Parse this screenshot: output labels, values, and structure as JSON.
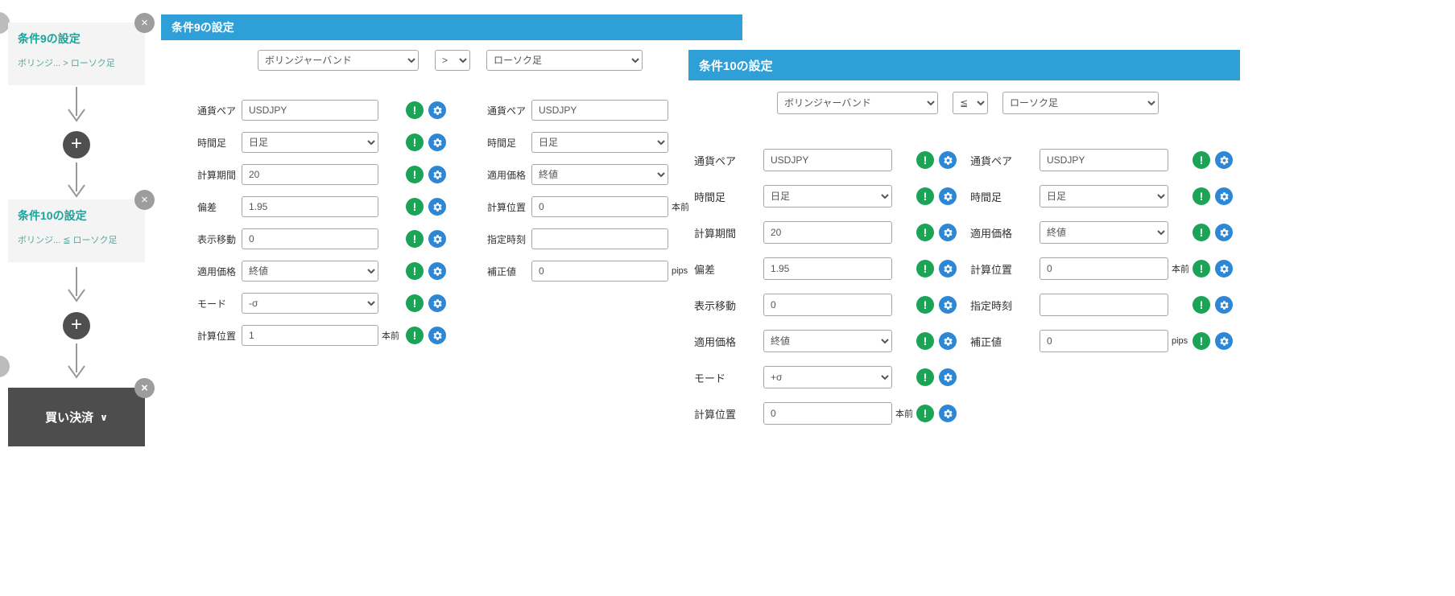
{
  "colors": {
    "header_blue": "#2f9fd8",
    "teal_title": "#18a39b",
    "alert_green": "#1ba456",
    "gear_blue": "#2d87d5",
    "dark_button": "#4d4d4d"
  },
  "sidebar": {
    "cards": [
      {
        "title": "条件9の設定",
        "subtitle": "ボリンジ... > ローソク足"
      },
      {
        "title": "条件10の設定",
        "subtitle": "ボリンジ... ≦ ローソク足"
      }
    ],
    "settle_label": "買い決済",
    "settle_chevron": "∨",
    "close_glyph": "×",
    "plus_glyph": "+"
  },
  "dialogs": [
    {
      "title": "条件9の設定",
      "indicator": "ボリンジャーバンド",
      "operator": ">",
      "target": "ローソク足",
      "left_fields": [
        {
          "label": "通貨ペア",
          "value": "USDJPY",
          "type": "text"
        },
        {
          "label": "時間足",
          "value": "日足",
          "type": "select"
        },
        {
          "label": "計算期間",
          "value": "20",
          "type": "text"
        },
        {
          "label": "偏差",
          "value": "1.95",
          "type": "text"
        },
        {
          "label": "表示移動",
          "value": "0",
          "type": "text"
        },
        {
          "label": "適用価格",
          "value": "終値",
          "type": "select"
        },
        {
          "label": "モード",
          "value": "-σ",
          "type": "select"
        },
        {
          "label": "計算位置",
          "value": "1",
          "type": "text",
          "suffix": "本前"
        }
      ],
      "right_fields": [
        {
          "label": "通貨ペア",
          "value": "USDJPY",
          "type": "text"
        },
        {
          "label": "時間足",
          "value": "日足",
          "type": "select"
        },
        {
          "label": "適用価格",
          "value": "終値",
          "type": "select"
        },
        {
          "label": "計算位置",
          "value": "0",
          "type": "text",
          "suffix": "本前"
        },
        {
          "label": "指定時刻",
          "value": "",
          "type": "text"
        },
        {
          "label": "補正値",
          "value": "0",
          "type": "text",
          "suffix": "pips"
        }
      ]
    },
    {
      "title": "条件10の設定",
      "indicator": "ボリンジャーバンド",
      "operator": "≦",
      "target": "ローソク足",
      "left_fields": [
        {
          "label": "通貨ペア",
          "value": "USDJPY",
          "type": "text"
        },
        {
          "label": "時間足",
          "value": "日足",
          "type": "select"
        },
        {
          "label": "計算期間",
          "value": "20",
          "type": "text"
        },
        {
          "label": "偏差",
          "value": "1.95",
          "type": "text"
        },
        {
          "label": "表示移動",
          "value": "0",
          "type": "text"
        },
        {
          "label": "適用価格",
          "value": "終値",
          "type": "select"
        },
        {
          "label": "モード",
          "value": "+σ",
          "type": "select"
        },
        {
          "label": "計算位置",
          "value": "0",
          "type": "text",
          "suffix": "本前"
        }
      ],
      "right_fields": [
        {
          "label": "通貨ペア",
          "value": "USDJPY",
          "type": "text"
        },
        {
          "label": "時間足",
          "value": "日足",
          "type": "select"
        },
        {
          "label": "適用価格",
          "value": "終値",
          "type": "select"
        },
        {
          "label": "計算位置",
          "value": "0",
          "type": "text",
          "suffix": "本前"
        },
        {
          "label": "指定時刻",
          "value": "",
          "type": "text"
        },
        {
          "label": "補正値",
          "value": "0",
          "type": "text",
          "suffix": "pips"
        }
      ]
    }
  ]
}
